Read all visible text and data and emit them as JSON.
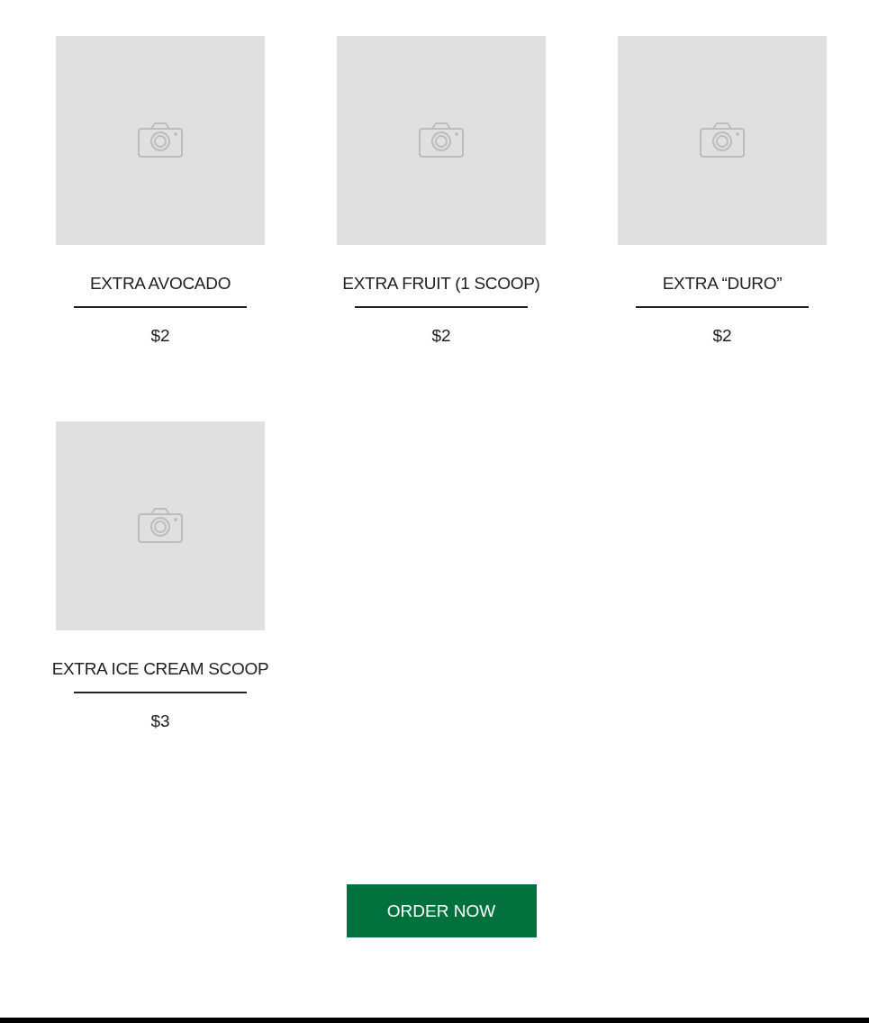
{
  "products": [
    {
      "name": "EXTRA AVOCADO",
      "price": "$2",
      "image": {
        "kind": "placeholder"
      }
    },
    {
      "name": "EXTRA FRUIT (1 SCOOP)",
      "price": "$2",
      "image": {
        "kind": "placeholder"
      }
    },
    {
      "name": "EXTRA “DURO”",
      "price": "$2",
      "image": {
        "kind": "placeholder"
      }
    },
    {
      "name": "EXTRA ICE CREAM SCOOP",
      "price": "$3",
      "image": {
        "kind": "placeholder"
      }
    }
  ],
  "order_button": "ORDER NOW"
}
